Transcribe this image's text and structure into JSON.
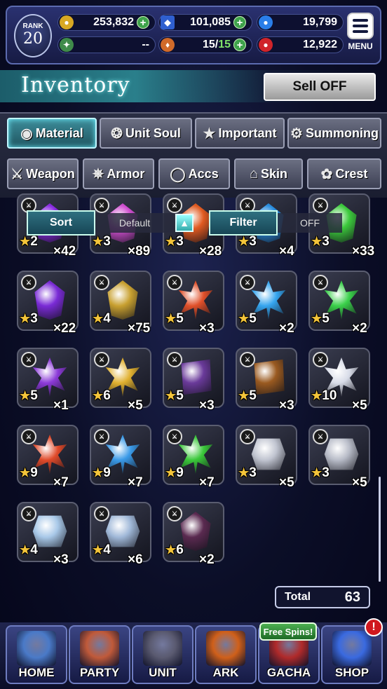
{
  "status": {
    "rank_label": "RANK",
    "rank": "20",
    "gil": "253,832",
    "lapis": "101,085",
    "blue_orbs": "19,799",
    "tickets": "--",
    "stamina": "15/",
    "stamina_max": "15",
    "red_orbs": "12,922",
    "menu_label": "MENU"
  },
  "header": {
    "title": "Inventory",
    "sell_label": "Sell OFF"
  },
  "tabs": [
    {
      "label": "Material",
      "icon": "bag-icon",
      "active": true
    },
    {
      "label": "Unit Soul",
      "icon": "soul-icon"
    },
    {
      "label": "Important",
      "icon": "star-icon"
    },
    {
      "label": "Summoning",
      "icon": "summon-icon"
    },
    {
      "label": "Weapon",
      "icon": "sword-icon"
    },
    {
      "label": "Armor",
      "icon": "armor-icon"
    },
    {
      "label": "Accs",
      "icon": "necklace-icon"
    },
    {
      "label": "Skin",
      "icon": "hanger-icon"
    },
    {
      "label": "Crest",
      "icon": "crest-icon"
    }
  ],
  "sort": {
    "sort_label": "Sort",
    "sort_value": "Default",
    "filter_label": "Filter",
    "filter_value": "OFF"
  },
  "items": [
    {
      "stars": "2",
      "qty": "×42",
      "color": "#8a2be2",
      "shape": "gem"
    },
    {
      "stars": "3",
      "qty": "×89",
      "color": "#d04fd0",
      "shape": "gem"
    },
    {
      "stars": "3",
      "qty": "×28",
      "color": "#e05a20",
      "shape": "gem"
    },
    {
      "stars": "3",
      "qty": "×4",
      "color": "#2a8ee0",
      "shape": "gem"
    },
    {
      "stars": "3",
      "qty": "×33",
      "color": "#3cc93c",
      "shape": "gem"
    },
    {
      "stars": "3",
      "qty": "×22",
      "color": "#7a2bd6",
      "shape": "gem"
    },
    {
      "stars": "4",
      "qty": "×75",
      "color": "#c8a030",
      "shape": "gem"
    },
    {
      "stars": "5",
      "qty": "×3",
      "color": "#e0502a",
      "shape": "flower"
    },
    {
      "stars": "5",
      "qty": "×2",
      "color": "#35a5ef",
      "shape": "flower"
    },
    {
      "stars": "5",
      "qty": "×2",
      "color": "#3ad04a",
      "shape": "flower"
    },
    {
      "stars": "5",
      "qty": "×1",
      "color": "#8c3ad8",
      "shape": "flower"
    },
    {
      "stars": "6",
      "qty": "×5",
      "color": "#e0b030",
      "shape": "flower"
    },
    {
      "stars": "5",
      "qty": "×3",
      "color": "#6a3a9a",
      "shape": "book"
    },
    {
      "stars": "5",
      "qty": "×3",
      "color": "#9a5a20",
      "shape": "book"
    },
    {
      "stars": "10",
      "qty": "×5",
      "color": "#d8dce8",
      "shape": "flower"
    },
    {
      "stars": "9",
      "qty": "×7",
      "color": "#e04a2a",
      "shape": "flower"
    },
    {
      "stars": "9",
      "qty": "×7",
      "color": "#3a9ae8",
      "shape": "flower"
    },
    {
      "stars": "9",
      "qty": "×7",
      "color": "#3ac83a",
      "shape": "flower"
    },
    {
      "stars": "3",
      "qty": "×5",
      "color": "#c0c4d0",
      "shape": "shield"
    },
    {
      "stars": "3",
      "qty": "×5",
      "color": "#b8bcc8",
      "shape": "shield"
    },
    {
      "stars": "4",
      "qty": "×3",
      "color": "#a8c8e8",
      "shape": "shield"
    },
    {
      "stars": "4",
      "qty": "×6",
      "color": "#a0b8d8",
      "shape": "shield"
    },
    {
      "stars": "6",
      "qty": "×2",
      "color": "#5a2a50",
      "shape": "gem"
    }
  ],
  "total": {
    "label": "Total",
    "value": "63"
  },
  "nav": {
    "free_spins": "Free Spins!",
    "alert": "!",
    "buttons": [
      {
        "label": "HOME",
        "color": "#4a7ac8"
      },
      {
        "label": "PARTY",
        "color": "#c05a3a"
      },
      {
        "label": "UNIT",
        "color": "#5a5a70"
      },
      {
        "label": "ARK",
        "color": "#d0601a"
      },
      {
        "label": "GACHA",
        "color": "#b02a2a"
      },
      {
        "label": "SHOP",
        "color": "#3a6ae0"
      }
    ]
  }
}
